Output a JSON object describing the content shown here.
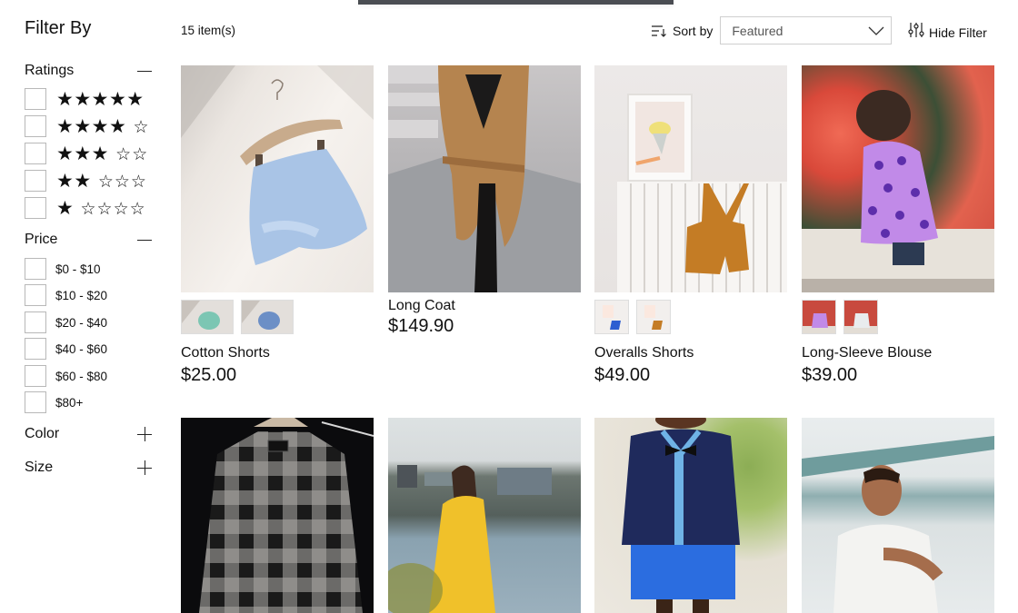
{
  "sidebar": {
    "title": "Filter By",
    "ratings": {
      "label": "Ratings",
      "toggle": "collapse",
      "options": [
        {
          "filled": "★★★★★",
          "empty": "",
          "stars": 5
        },
        {
          "filled": "★★★★",
          "empty": "☆",
          "stars": 4
        },
        {
          "filled": "★★★",
          "empty": "☆☆",
          "stars": 3
        },
        {
          "filled": "★★",
          "empty": "☆☆☆",
          "stars": 2
        },
        {
          "filled": "★",
          "empty": "☆☆☆☆",
          "stars": 1
        }
      ]
    },
    "price": {
      "label": "Price",
      "toggle": "collapse",
      "options": [
        "$0 - $10",
        "$10 - $20",
        "$20 - $40",
        "$40 - $60",
        "$60 - $80",
        "$80+"
      ]
    },
    "color": {
      "label": "Color",
      "toggle": "expand"
    },
    "size": {
      "label": "Size",
      "toggle": "expand"
    }
  },
  "toolbar": {
    "item_count": "15 item(s)",
    "sort_label": "Sort by",
    "sort_value": "Featured",
    "hide_filter_label": "Hide Filter"
  },
  "products": [
    {
      "name": "Cotton Shorts",
      "price": "$25.00",
      "image": "light blue cotton shorts on wooden hanger",
      "thumbs": [
        "mint-green variant",
        "blue variant"
      ]
    },
    {
      "name": "Long Coat",
      "price": "$149.90",
      "image": "camel belted wrap coat on stone steps",
      "thumbs": []
    },
    {
      "name": "Overalls Shorts",
      "price": "$49.00",
      "image": "mustard overalls shorts on white radiator",
      "thumbs": [
        "blue variant",
        "mustard variant"
      ]
    },
    {
      "name": "Long-Sleeve Blouse",
      "price": "$39.00",
      "image": "child in purple polka-dot blouse by red flowers",
      "thumbs": [
        "purple variant",
        "white variant"
      ]
    },
    {
      "name": "",
      "price": "",
      "image": "black and grey buffalo check flannel shirt on hanger"
    },
    {
      "name": "",
      "price": "",
      "image": "woman in yellow raincoat by river"
    },
    {
      "name": "",
      "price": "",
      "image": "boy in navy cardigan with bow tie and blue shorts"
    },
    {
      "name": "",
      "price": "",
      "image": "man in white short-sleeve shirt"
    }
  ],
  "colors": {
    "text": "#111111",
    "border": "#cfcfcf",
    "checkbox_border": "#b8b8b8",
    "top_indicator": "#4a4d52"
  }
}
